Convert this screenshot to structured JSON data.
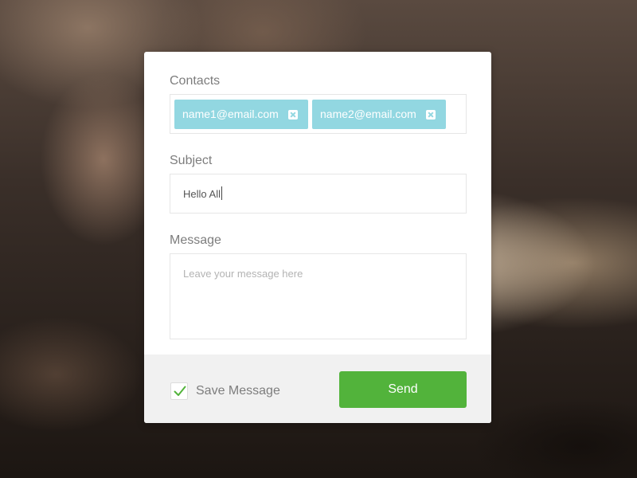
{
  "form": {
    "contacts_label": "Contacts",
    "contacts": [
      {
        "email": "name1@email.com"
      },
      {
        "email": "name2@email.com"
      }
    ],
    "subject_label": "Subject",
    "subject_value": "Hello All",
    "message_label": "Message",
    "message_placeholder": "Leave your message here",
    "message_value": ""
  },
  "footer": {
    "save_label": "Save Message",
    "save_checked": true,
    "send_label": "Send"
  },
  "colors": {
    "chip": "#92d7e1",
    "send_button": "#52b33b",
    "checkmark": "#52b33b"
  },
  "icons": {
    "chip_remove": "close-icon",
    "checkbox": "checkmark-icon"
  }
}
